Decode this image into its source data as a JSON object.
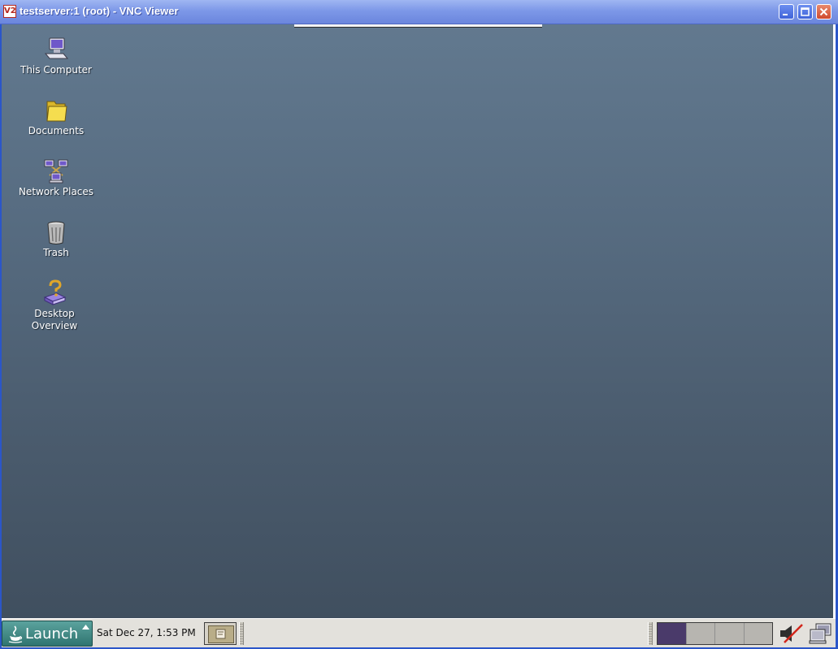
{
  "window": {
    "title": "testserver:1 (root) - VNC Viewer",
    "app_icon_text": "V2",
    "controls": [
      "minimize",
      "maximize",
      "close"
    ]
  },
  "desktop": {
    "icons": [
      {
        "label": "This Computer",
        "icon": "computer-icon"
      },
      {
        "label": "Documents",
        "icon": "folder-icon"
      },
      {
        "label": "Network Places",
        "icon": "network-icon"
      },
      {
        "label": "Trash",
        "icon": "trash-icon"
      },
      {
        "label": "Desktop Overview",
        "icon": "help-book-icon"
      }
    ]
  },
  "panel": {
    "launch_label": "Launch",
    "clock": "Sat Dec 27,  1:53 PM",
    "workspaces": [
      {
        "active": true
      },
      {
        "active": false
      },
      {
        "active": false
      },
      {
        "active": false
      }
    ]
  },
  "colors": {
    "titlebar": "#7d98e8",
    "desktop_top": "#62798f",
    "desktop_bottom": "#404f5f",
    "panel": "#e3e1dc",
    "launch": "#3f8a85",
    "active_workspace": "#4a3a6a"
  }
}
